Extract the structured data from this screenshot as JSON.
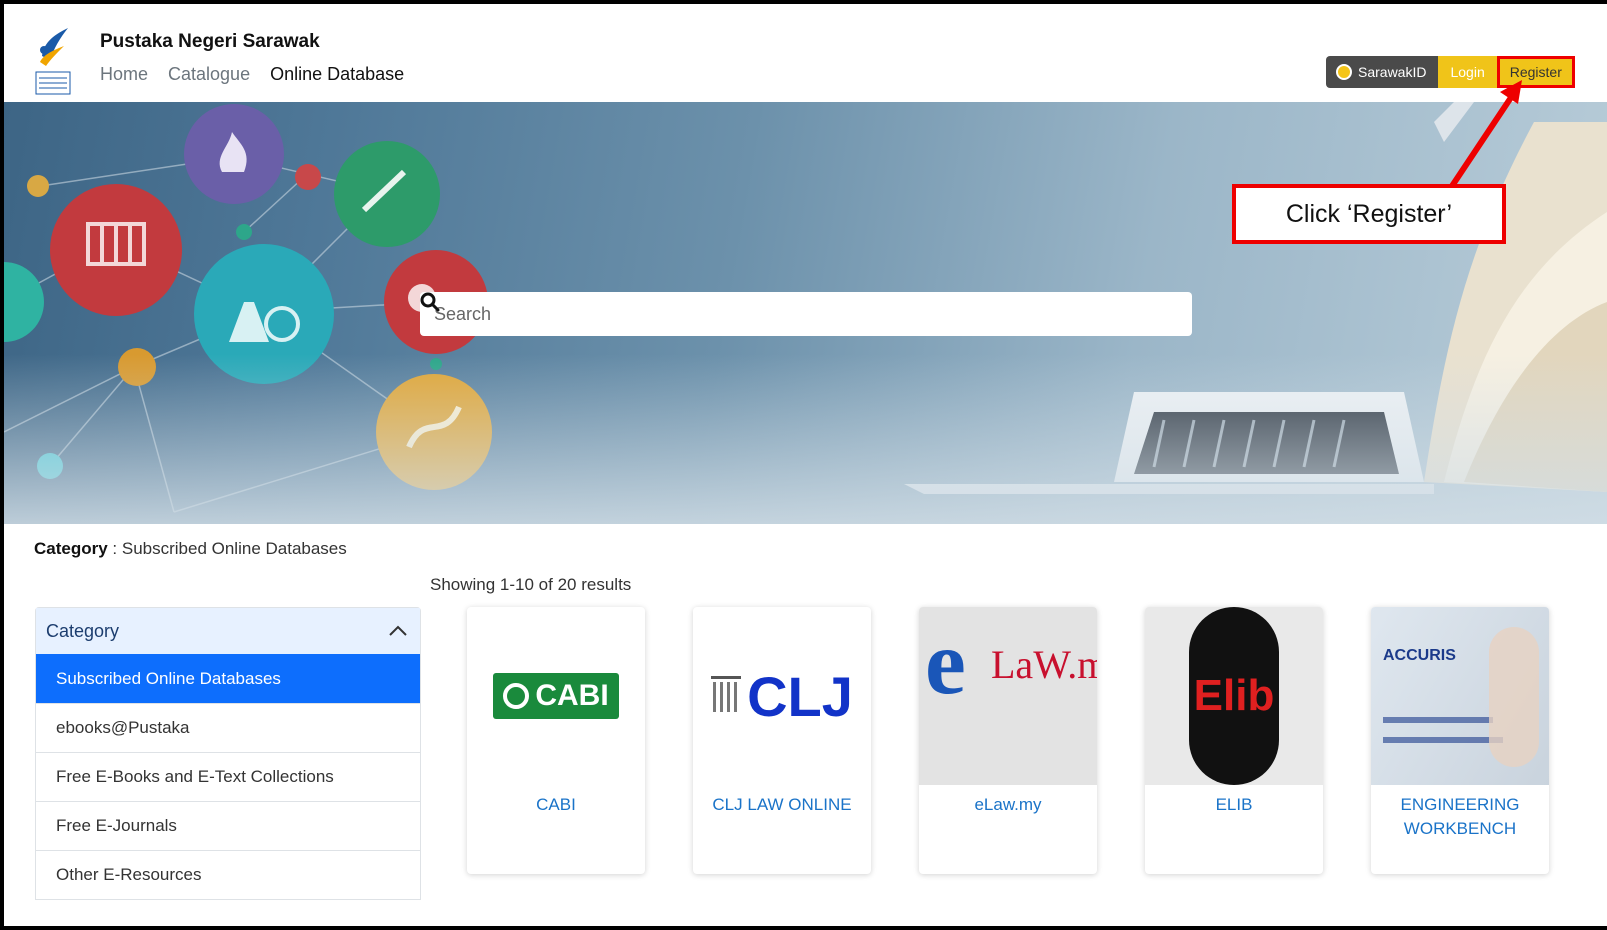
{
  "header": {
    "site_name": "Pustaka Negeri Sarawak",
    "nav": [
      "Home",
      "Catalogue",
      "Online Database"
    ],
    "sarawak_id_label": "SarawakID",
    "login_label": "Login",
    "register_label": "Register"
  },
  "search": {
    "placeholder": "Search"
  },
  "callout": {
    "text": "Click ‘Register’"
  },
  "category_line": {
    "label": "Category",
    "value": " : Subscribed Online Databases"
  },
  "results": {
    "text": "Showing 1-10 of 20 results"
  },
  "sidebar": {
    "header": "Category",
    "items": [
      "Subscribed Online Databases",
      "ebooks@Pustaka",
      "Free E-Books and E-Text Collections",
      "Free E-Journals",
      "Other E-Resources"
    ]
  },
  "cards": [
    {
      "title": "CABI",
      "logo_text": "CABI"
    },
    {
      "title": "CLJ LAW ONLINE",
      "logo_text": "CLJ"
    },
    {
      "title": "eLaw.my",
      "logo_text": "LaW.my"
    },
    {
      "title": "ELIB",
      "logo_text": "Elib"
    },
    {
      "title": "ENGINEERING WORKBENCH",
      "logo_text": "ACCURIS"
    }
  ],
  "colors": {
    "accent_yellow": "#f0c419",
    "annotation_red": "#ee0000",
    "primary_blue": "#0d6efd"
  }
}
